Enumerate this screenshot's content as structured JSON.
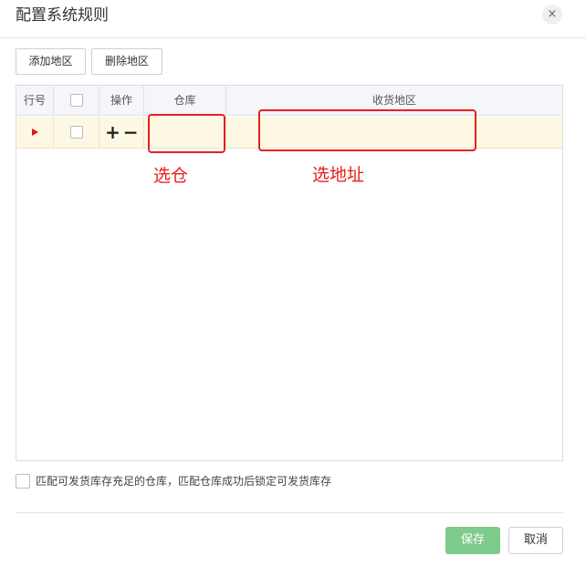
{
  "dialog": {
    "title": "配置系统规则",
    "close_glyph": "×"
  },
  "toolbar": {
    "add_label": "添加地区",
    "delete_label": "删除地区"
  },
  "grid": {
    "columns": [
      "行号",
      "",
      "操作",
      "仓库",
      "收货地区"
    ],
    "rows": [
      {
        "selected": true,
        "plus": "+",
        "minus": "−",
        "warehouse": "",
        "region": ""
      }
    ]
  },
  "annotations": {
    "warehouse": "选仓",
    "region": "选地址",
    "color": "#e8201c"
  },
  "option": {
    "label": "匹配可发货库存充足的仓库，匹配仓库成功后锁定可发货库存",
    "checked": false
  },
  "footer": {
    "save_label": "保存",
    "cancel_label": "取消",
    "save_color": "#7ecb8e"
  }
}
